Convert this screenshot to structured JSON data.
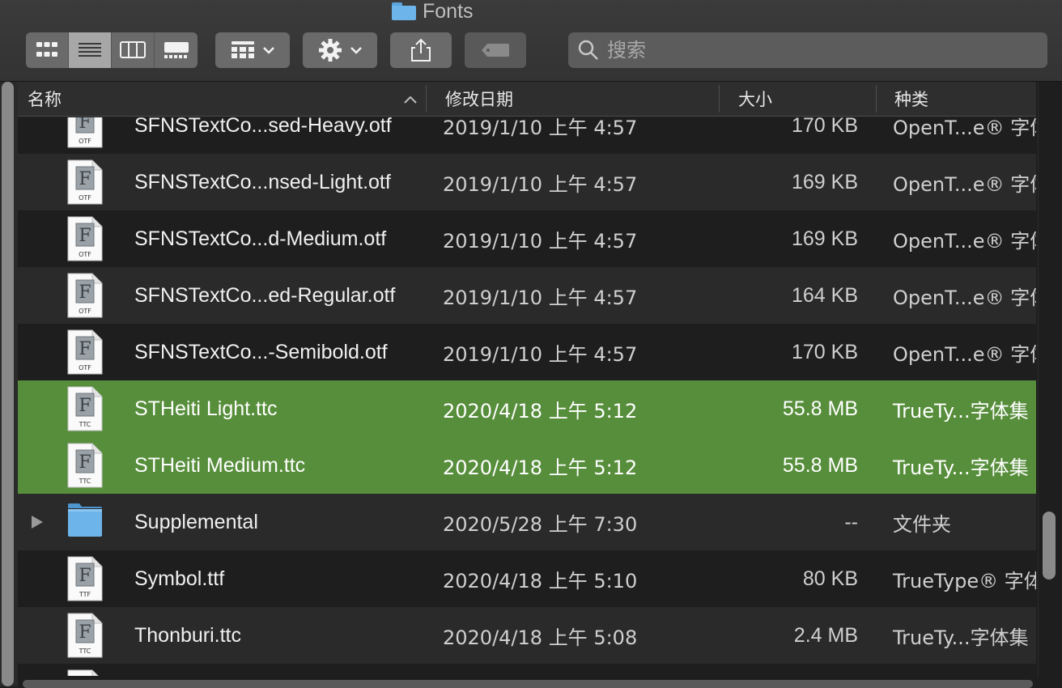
{
  "window": {
    "title": "Fonts"
  },
  "toolbar": {
    "view_modes": [
      {
        "name": "icon-view",
        "active": false
      },
      {
        "name": "list-view",
        "active": true
      },
      {
        "name": "column-view",
        "active": false
      },
      {
        "name": "gallery-view",
        "active": false
      }
    ],
    "group_icon": "grid-group-icon",
    "action_icon": "gear-icon",
    "share_icon": "share-icon",
    "tag_icon": "tag-icon"
  },
  "search": {
    "placeholder": "搜索",
    "value": ""
  },
  "columns": {
    "name": "名称",
    "date": "修改日期",
    "size": "大小",
    "kind": "种类"
  },
  "rows": [
    {
      "icon": "otf",
      "name": "SFNSTextCo...sed-Heavy.otf",
      "date": "2019/1/10 上午 4:57",
      "size": "170 KB",
      "kind": "OpenT...e® 字体",
      "selected": false
    },
    {
      "icon": "otf",
      "name": "SFNSTextCo...nsed-Light.otf",
      "date": "2019/1/10 上午 4:57",
      "size": "169 KB",
      "kind": "OpenT...e® 字体",
      "selected": false
    },
    {
      "icon": "otf",
      "name": "SFNSTextCo...d-Medium.otf",
      "date": "2019/1/10 上午 4:57",
      "size": "169 KB",
      "kind": "OpenT...e® 字体",
      "selected": false
    },
    {
      "icon": "otf",
      "name": "SFNSTextCo...ed-Regular.otf",
      "date": "2019/1/10 上午 4:57",
      "size": "164 KB",
      "kind": "OpenT...e® 字体",
      "selected": false
    },
    {
      "icon": "otf",
      "name": "SFNSTextCo...-Semibold.otf",
      "date": "2019/1/10 上午 4:57",
      "size": "170 KB",
      "kind": "OpenT...e® 字体",
      "selected": false
    },
    {
      "icon": "ttc",
      "name": "STHeiti Light.ttc",
      "date": "2020/4/18 上午 5:12",
      "size": "55.8 MB",
      "kind": "TrueTy...字体集",
      "selected": true
    },
    {
      "icon": "ttc",
      "name": "STHeiti Medium.ttc",
      "date": "2020/4/18 上午 5:12",
      "size": "55.8 MB",
      "kind": "TrueTy...字体集",
      "selected": true
    },
    {
      "icon": "folder",
      "name": "Supplemental",
      "date": "2020/5/28 上午 7:30",
      "size": "--",
      "kind": "文件夹",
      "selected": false
    },
    {
      "icon": "ttf",
      "name": "Symbol.ttf",
      "date": "2020/4/18 上午 5:10",
      "size": "80 KB",
      "kind": "TrueType® 字体",
      "selected": false
    },
    {
      "icon": "ttc",
      "name": "Thonburi.ttc",
      "date": "2020/4/18 上午 5:08",
      "size": "2.4 MB",
      "kind": "TrueTy...字体集",
      "selected": false
    },
    {
      "icon": "ttf",
      "name": "",
      "date": "",
      "size": "",
      "kind": "",
      "selected": false
    }
  ],
  "colors": {
    "selection": "#578e3b",
    "row_alt": "#2a2a2a",
    "row": "#1e1e1e",
    "folder": "#6db4ea"
  }
}
